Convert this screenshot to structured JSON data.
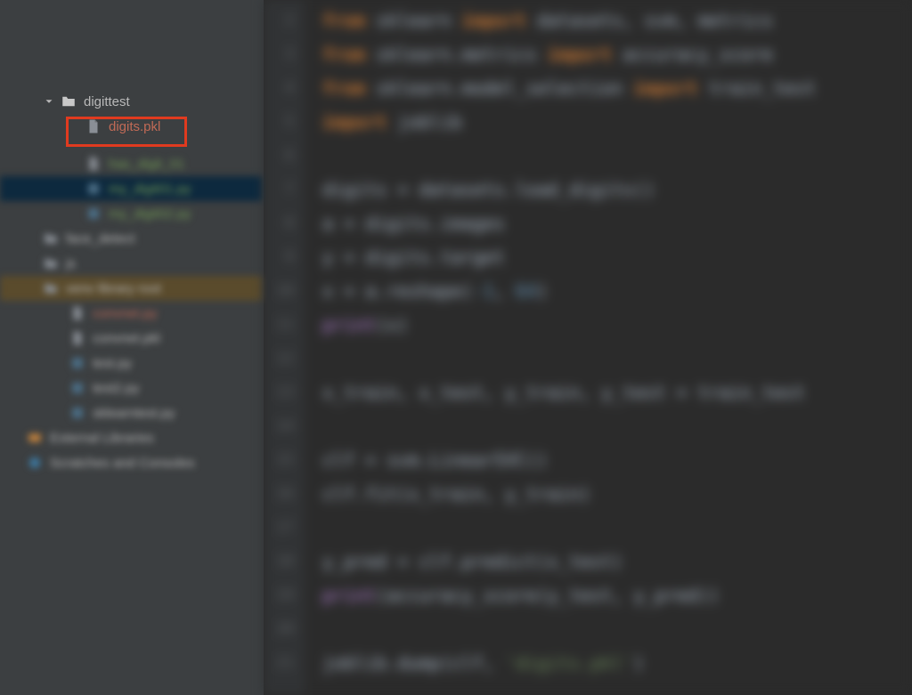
{
  "sidebar": {
    "top_blur": [
      {
        "icon": "folder",
        "label": ""
      },
      {
        "icon": "folder",
        "label": ""
      },
      {
        "icon": "folder",
        "label": ""
      },
      {
        "icon": "folder",
        "label": ""
      }
    ],
    "folder": {
      "name": "digittest"
    },
    "file": {
      "name": "digits.pkl"
    },
    "mid_blur": [
      {
        "indent": 3,
        "icon": "file",
        "label": "has_digit_01",
        "cls": "green",
        "row": ""
      },
      {
        "indent": 3,
        "icon": "py",
        "label": "my_digit01.py",
        "cls": "green",
        "row": "row-selected"
      },
      {
        "indent": 3,
        "icon": "py",
        "label": "my_digit02.py",
        "cls": "green",
        "row": ""
      },
      {
        "indent": 1,
        "icon": "folder",
        "label": "face_detect",
        "cls": "",
        "row": ""
      },
      {
        "indent": 1,
        "icon": "folder",
        "label": "js",
        "cls": "",
        "row": ""
      },
      {
        "indent": 1,
        "icon": "folder",
        "label": "venv  library root",
        "cls": "",
        "row": "row-highlight"
      },
      {
        "indent": 2,
        "icon": "file",
        "label": "convnet.py",
        "cls": "red",
        "row": ""
      },
      {
        "indent": 2,
        "icon": "file",
        "label": "convnet.pkl",
        "cls": "",
        "row": ""
      },
      {
        "indent": 2,
        "icon": "py",
        "label": "test.py",
        "cls": "",
        "row": ""
      },
      {
        "indent": 2,
        "icon": "py",
        "label": "test2.py",
        "cls": "",
        "row": ""
      },
      {
        "indent": 2,
        "icon": "py",
        "label": "sklearntest.py",
        "cls": "",
        "row": ""
      },
      {
        "indent": 0,
        "icon": "lib",
        "label": "External Libraries",
        "cls": "",
        "row": ""
      },
      {
        "indent": 0,
        "icon": "scratch",
        "label": "Scratches and Consoles",
        "cls": "",
        "row": ""
      }
    ]
  },
  "editor": {
    "line_start": 2,
    "lines": [
      {
        "html": "<span class='kw'>from</span> sklearn <span class='kw'>import</span> datasets, svm, metrics"
      },
      {
        "html": "<span class='kw'>from</span> sklearn.metrics <span class='kw'>import</span> accuracy_score"
      },
      {
        "html": "<span class='kw'>from</span> sklearn.model_selection <span class='kw'>import</span> train_test"
      },
      {
        "html": "<span class='kw'>import</span> joblib"
      },
      {
        "html": ""
      },
      {
        "html": "digits = datasets.load_digits()"
      },
      {
        "html": "a = digits.images"
      },
      {
        "html": "y = digits.target"
      },
      {
        "html": "x = a.reshape(<span class='num'>-1</span>, <span class='num'>64</span>)"
      },
      {
        "html": "<span class='fn'>print</span>(x)"
      },
      {
        "html": ""
      },
      {
        "html": "x_train, x_test, y_train, y_test = train_test"
      },
      {
        "html": ""
      },
      {
        "html": "clf = svm.LinearSVC()"
      },
      {
        "html": "clf.fit(x_train, y_train)"
      },
      {
        "html": ""
      },
      {
        "html": "y_pred = clf.predict(x_test)"
      },
      {
        "html": "<span class='fn'>print</span>(accuracy_score(y_test, y_pred))"
      },
      {
        "html": ""
      },
      {
        "html": "joblib.dump(clf, <span class='str'>'digits.pkl'</span>)"
      }
    ]
  }
}
